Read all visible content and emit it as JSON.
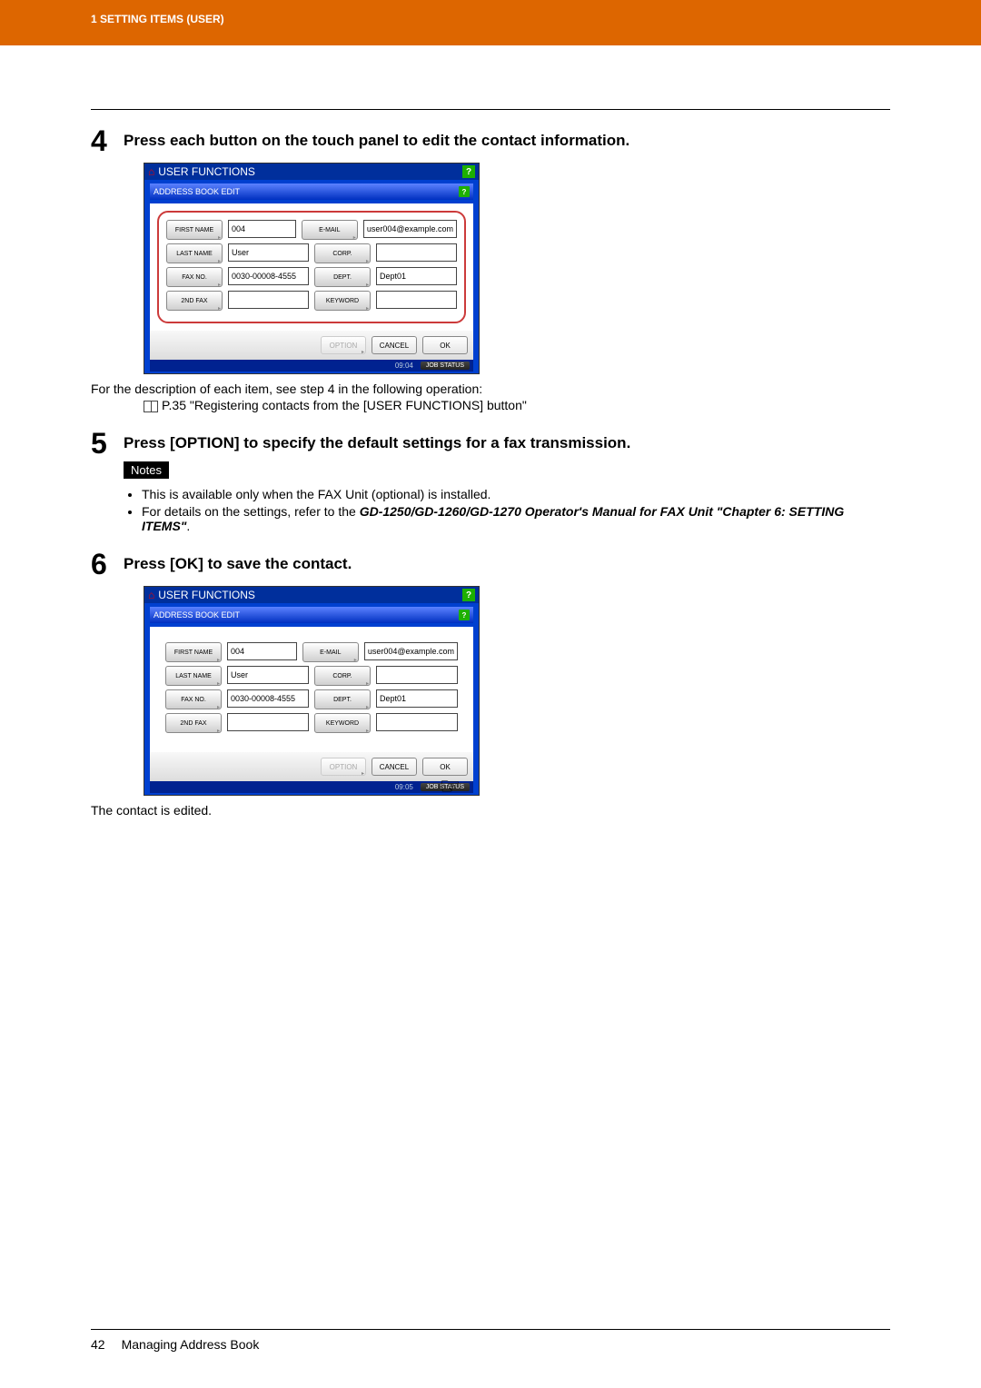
{
  "header": {
    "section_label": "1 SETTING ITEMS (USER)"
  },
  "steps": {
    "s4": {
      "num": "4",
      "title": "Press each button on the touch panel to edit the contact information.",
      "desc_line": "For the description of each item, see step 4 in the following operation:",
      "ref_line": "P.35 \"Registering contacts from the [USER FUNCTIONS] button\""
    },
    "s5": {
      "num": "5",
      "title": "Press [OPTION] to specify the default settings for a fax transmission.",
      "notes_label": "Notes",
      "note1": "This is available only when the FAX Unit (optional) is installed.",
      "note2_a": "For details on the settings, refer to the ",
      "note2_b": "GD-1250/GD-1260/GD-1270 Operator's Manual for FAX Unit \"Chapter 6: SETTING ITEMS\"",
      "note2_c": "."
    },
    "s6": {
      "num": "6",
      "title": "Press [OK] to save the contact.",
      "after": "The contact is edited."
    }
  },
  "panel": {
    "title": "USER FUNCTIONS",
    "header": "ADDRESS BOOK EDIT",
    "help": "?",
    "labels": {
      "first_name": "FIRST NAME",
      "last_name": "LAST NAME",
      "fax_no": "FAX NO.",
      "second_fax": "2ND FAX",
      "email": "E-MAIL",
      "corp": "CORP.",
      "dept": "DEPT.",
      "keyword": "KEYWORD"
    },
    "values": {
      "first_name": "004",
      "last_name": "User",
      "fax_no": "0030-00008-4555",
      "second_fax": "",
      "email": "user004@example.com",
      "corp": "",
      "dept": "Dept01",
      "keyword": ""
    },
    "buttons": {
      "option": "OPTION",
      "cancel": "CANCEL",
      "ok": "OK"
    },
    "status": {
      "time1": "09:04",
      "time2": "09:05",
      "job": "JOB STATUS"
    }
  },
  "footer": {
    "page": "42",
    "title": "Managing Address Book"
  }
}
